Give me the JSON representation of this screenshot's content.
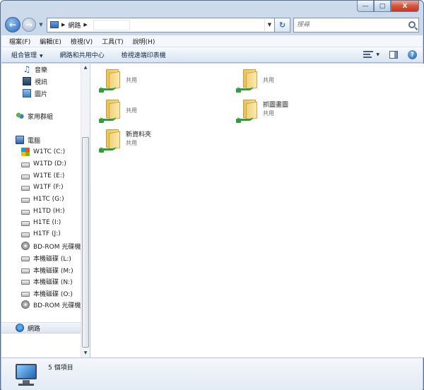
{
  "window": {
    "min_glyph": "—",
    "max_glyph": "□",
    "close_glyph": "X"
  },
  "address": {
    "segments": [
      "網路"
    ]
  },
  "search": {
    "placeholder": "搜尋"
  },
  "menubar": {
    "items": [
      "檔案(F)",
      "編輯(E)",
      "檢視(V)",
      "工具(T)",
      "說明(H)"
    ]
  },
  "commandbar": {
    "items": [
      "組合管理",
      "網路和共用中心",
      "檢視遠端印表機"
    ]
  },
  "navpane": {
    "items": [
      {
        "label": "音樂",
        "icon": "music-icon"
      },
      {
        "label": "視訊",
        "icon": "video-icon"
      },
      {
        "label": "圖片",
        "icon": "pictures-icon"
      },
      {
        "label": "家用群組",
        "icon": "homegroup-icon"
      },
      {
        "label": "電腦",
        "icon": "computer-icon"
      },
      {
        "label": "W1TC (C:)",
        "icon": "system-drive-icon"
      },
      {
        "label": "W1TD (D:)",
        "icon": "drive-icon"
      },
      {
        "label": "W1TE (E:)",
        "icon": "drive-icon"
      },
      {
        "label": "W1TF (F:)",
        "icon": "drive-icon"
      },
      {
        "label": "H1TC (G:)",
        "icon": "drive-icon"
      },
      {
        "label": "H1TD (H:)",
        "icon": "drive-icon"
      },
      {
        "label": "H1TE (I:)",
        "icon": "drive-icon"
      },
      {
        "label": "H1TF (J:)",
        "icon": "drive-icon"
      },
      {
        "label": "BD-ROM 光碟機",
        "icon": "cd-drive-icon"
      },
      {
        "label": "本機磁碟 (L:)",
        "icon": "drive-icon"
      },
      {
        "label": "本機磁碟 (M:)",
        "icon": "drive-icon"
      },
      {
        "label": "本機磁碟 (N:)",
        "icon": "drive-icon"
      },
      {
        "label": "本機磁碟 (O:)",
        "icon": "drive-icon"
      },
      {
        "label": "BD-ROM 光碟機",
        "icon": "cd-drive-icon"
      },
      {
        "label": "網路",
        "icon": "network-icon",
        "selected": true
      }
    ]
  },
  "shares": [
    {
      "name": "",
      "sub": "共用"
    },
    {
      "name": "",
      "sub": "共用"
    },
    {
      "name": "",
      "sub": "共用"
    },
    {
      "name": "抓圖畫圖",
      "sub": "共用"
    },
    {
      "name": "新資料夾",
      "sub": "共用"
    }
  ],
  "details": {
    "summary": "5 個項目"
  }
}
